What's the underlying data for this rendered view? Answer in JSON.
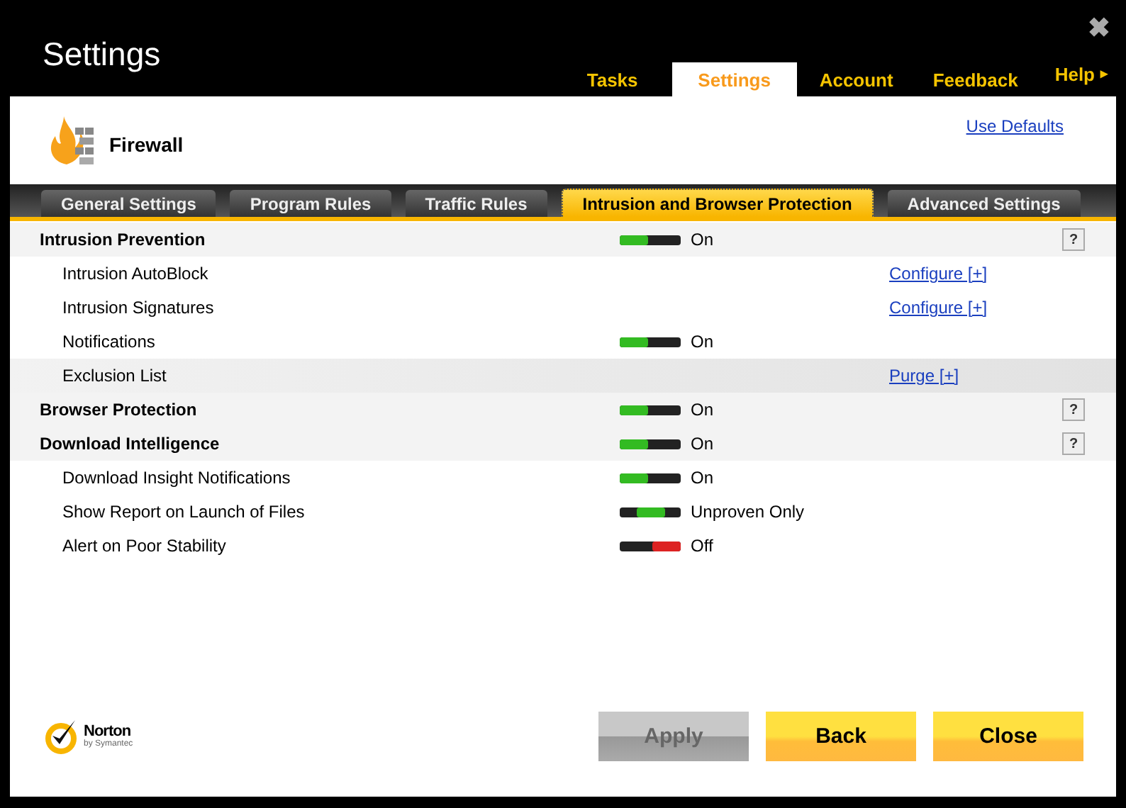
{
  "window": {
    "title": "Settings",
    "close": "✖"
  },
  "nav_tabs": [
    {
      "label": "Tasks",
      "selected": false
    },
    {
      "label": "Settings",
      "selected": true
    },
    {
      "label": "Account",
      "selected": false
    },
    {
      "label": "Feedback",
      "selected": false
    }
  ],
  "help": {
    "label": "Help",
    "arrow": "▸"
  },
  "page": {
    "title": "Firewall",
    "defaults_link": "Use Defaults"
  },
  "sub_tabs": [
    {
      "label": "General Settings",
      "selected": false
    },
    {
      "label": "Program Rules",
      "selected": false
    },
    {
      "label": "Traffic Rules",
      "selected": false
    },
    {
      "label": "Intrusion and Browser Protection",
      "selected": true
    },
    {
      "label": "Advanced Settings",
      "selected": false
    }
  ],
  "rows": [
    {
      "kind": "section",
      "label": "Intrusion Prevention",
      "on": true,
      "status": "On",
      "help": "?"
    },
    {
      "kind": "item",
      "label": "Intrusion AutoBlock",
      "link": "Configure [+]",
      "highlighted": false
    },
    {
      "kind": "item",
      "label": "Intrusion Signatures",
      "link": "Configure [+]",
      "highlighted": false
    },
    {
      "kind": "item",
      "label": "Notifications",
      "on": true,
      "status": "On",
      "highlighted": false
    },
    {
      "kind": "item",
      "label": "Exclusion List",
      "link": "Purge [+]",
      "highlighted": true
    },
    {
      "kind": "section",
      "label": "Browser Protection",
      "on": true,
      "status": "On",
      "help": "?"
    },
    {
      "kind": "section",
      "label": "Download Intelligence",
      "on": true,
      "status": "On",
      "help": "?"
    },
    {
      "kind": "item",
      "label": "Download Insight Notifications",
      "on": true,
      "partial": false,
      "status": "On",
      "highlighted": false
    },
    {
      "kind": "item",
      "label": "Show Report on Launch of Files",
      "on": true,
      "partial": true,
      "status": "Unproven Only",
      "highlighted": false
    },
    {
      "kind": "item",
      "label": "Alert on Poor Stability",
      "on": false,
      "partial": false,
      "status": "Off",
      "highlighted": false
    }
  ],
  "logo": {
    "name": "Norton",
    "tagline": "by Symantec"
  },
  "buttons": [
    {
      "label": "Apply",
      "disabled": true
    },
    {
      "label": "Back",
      "disabled": false
    },
    {
      "label": "Close",
      "disabled": false
    }
  ]
}
